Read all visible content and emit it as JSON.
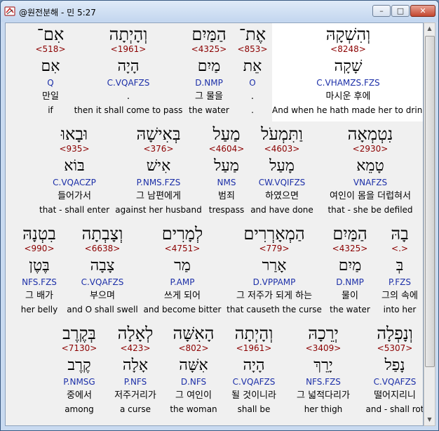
{
  "window": {
    "title": "@원전분해 - 민 5:27",
    "app_icon": "book-icon",
    "controls": [
      "minimize",
      "maximize",
      "close"
    ],
    "minimize_glyph": "–",
    "maximize_glyph": "□",
    "close_glyph": "✕"
  },
  "scrollbar": {
    "up_glyph": "▲",
    "down_glyph": "▼"
  },
  "rows": [
    {
      "words": [
        {
          "hebrew": "וְהִשְׁקָהּ",
          "strong": "<8248>",
          "lemma": "שָׁקָה",
          "morph": "C.VHAMZS.FZS",
          "korean": "마시운 후에",
          "english": "And when he hath made her to drink",
          "highlighted": true
        },
        {
          "hebrew": "אֶת־",
          "strong": "<853>",
          "lemma": "אֵת",
          "morph": "O",
          "korean": ".",
          "english": "."
        },
        {
          "hebrew": "הַמַּיִם",
          "strong": "<4325>",
          "lemma": "מַיִם",
          "morph": "D.NMP",
          "korean": "그 물을",
          "english": "the water"
        },
        {
          "hebrew": "וְהָיְתָה",
          "strong": "<1961>",
          "lemma": "הָיָה",
          "morph": "C.VQAFZS",
          "korean": ".",
          "english": "then it shall come to pass"
        },
        {
          "hebrew": "אִם־",
          "strong": "<518>",
          "lemma": "אִם",
          "morph": "Q",
          "korean": "만일",
          "english": "if"
        }
      ]
    },
    {
      "words": [
        {
          "hebrew": "נִטְמְאָה",
          "strong": "<2930>",
          "lemma": "טָמֵא",
          "morph": "VNAFZS",
          "korean": "여인이 몸을 더럽혀서",
          "english": "that - she be defiled"
        },
        {
          "hebrew": "וַתִּמְעֹל",
          "strong": "<4603>",
          "lemma": "מָעַל",
          "morph": "CW.VQIFZS",
          "korean": "하였으면",
          "english": "and have done"
        },
        {
          "hebrew": "מַעַל",
          "strong": "<4604>",
          "lemma": "מַעַל",
          "morph": "NMS",
          "korean": "범죄",
          "english": "trespass"
        },
        {
          "hebrew": "בְּאִישָׁהּ",
          "strong": "<376>",
          "lemma": "אִישׁ",
          "morph": "P.NMS.FZS",
          "korean": "그 남편에게",
          "english": "against her husband"
        },
        {
          "hebrew": "וּבָאוּ",
          "strong": "<935>",
          "lemma": "בּוֹא",
          "morph": "C.VQACZP",
          "korean": "들어가서",
          "english": "that - shall enter"
        }
      ]
    },
    {
      "words": [
        {
          "hebrew": "בָהּ",
          "strong": "<.>",
          "lemma": "בְּ",
          "morph": "P.FZS",
          "korean": "그의 속에",
          "english": "into her"
        },
        {
          "hebrew": "הַמַּיִם",
          "strong": "<4325>",
          "lemma": "מַיִם",
          "morph": "D.NMP",
          "korean": "물이",
          "english": "the water"
        },
        {
          "hebrew": "הַמְאָרְרִים",
          "strong": "<779>",
          "lemma": "אָרַר",
          "morph": "D.VPPAMP",
          "korean": "그 저주가 되게 하는",
          "english": "that causeth the curse"
        },
        {
          "hebrew": "לְמָרִים",
          "strong": "<4751>",
          "lemma": "מַר",
          "morph": "P.AMP",
          "korean": "쓰게 되어",
          "english": "and become bitter"
        },
        {
          "hebrew": "וְצָבְתָה",
          "strong": "<6638>",
          "lemma": "צָבָה",
          "morph": "C.VQAFZS",
          "korean": "부으며",
          "english": "and O shall swell"
        },
        {
          "hebrew": "בִטְנָהּ",
          "strong": "<990>",
          "lemma": "בֶּטֶן",
          "morph": "NFS.FZS",
          "korean": "그 배가",
          "english": "her belly"
        }
      ]
    },
    {
      "words": [
        {
          "hebrew": "וְנָפְלָה",
          "strong": "<5307>",
          "lemma": "נָפַל",
          "morph": "C.VQAFZS",
          "korean": "떨어지리니",
          "english": "and - shall rot"
        },
        {
          "hebrew": "יְרֵכָהּ",
          "strong": "<3409>",
          "lemma": "יָרֵךְ",
          "morph": "NFS.FZS",
          "korean": "그 넓적다리가",
          "english": "her thigh"
        },
        {
          "hebrew": "וְהָיְתָה",
          "strong": "<1961>",
          "lemma": "הָיָה",
          "morph": "C.VQAFZS",
          "korean": "될 것이니라",
          "english": "shall be"
        },
        {
          "hebrew": "הָאִשָּׁה",
          "strong": "<802>",
          "lemma": "אִשָּׁה",
          "morph": "D.NFS",
          "korean": "그 여인이",
          "english": "the woman"
        },
        {
          "hebrew": "לְאָלָה",
          "strong": "<423>",
          "lemma": "אָלָה",
          "morph": "P.NFS",
          "korean": "저주거리가",
          "english": "a curse"
        },
        {
          "hebrew": "בְּקֶרֶב",
          "strong": "<7130>",
          "lemma": "קֶרֶב",
          "morph": "P.NMSG",
          "korean": "중에서",
          "english": "among"
        }
      ]
    }
  ]
}
